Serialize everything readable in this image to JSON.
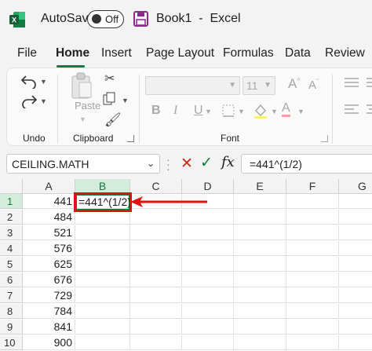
{
  "titlebar": {
    "autosave_label": "AutoSave",
    "toggle_state": "Off",
    "document_title": "Book1  -  Excel",
    "app_icon": "excel-logo",
    "save_icon": "save-icon"
  },
  "menu": {
    "tabs": [
      {
        "label": "File",
        "active": false
      },
      {
        "label": "Home",
        "active": true
      },
      {
        "label": "Insert",
        "active": false
      },
      {
        "label": "Page Layout",
        "active": false
      },
      {
        "label": "Formulas",
        "active": false
      },
      {
        "label": "Data",
        "active": false
      },
      {
        "label": "Review",
        "active": false
      }
    ]
  },
  "ribbon": {
    "groups": [
      {
        "label": "Undo"
      },
      {
        "label": "Clipboard"
      },
      {
        "label": "Font"
      }
    ],
    "paste_label": "Paste",
    "font_size_value": "11",
    "bold_glyph": "B",
    "italic_glyph": "I",
    "underline_glyph": "U"
  },
  "formula_bar": {
    "name_box": "CEILING.MATH",
    "cancel_glyph": "✕",
    "enter_glyph": "✓",
    "fx_label": "fx",
    "formula": "=441^(1/2)"
  },
  "sheet": {
    "columns": [
      "A",
      "B",
      "C",
      "D",
      "E",
      "F",
      "G"
    ],
    "selected_column": "B",
    "rows": [
      {
        "row": "1",
        "a": "441"
      },
      {
        "row": "2",
        "a": "484"
      },
      {
        "row": "3",
        "a": "521"
      },
      {
        "row": "4",
        "a": "576"
      },
      {
        "row": "5",
        "a": "625"
      },
      {
        "row": "6",
        "a": "676"
      },
      {
        "row": "7",
        "a": "729"
      },
      {
        "row": "8",
        "a": "784"
      },
      {
        "row": "9",
        "a": "841"
      },
      {
        "row": "10",
        "a": "900"
      }
    ],
    "editing_cell": "B1",
    "editing_value": "=441^(1/2)"
  },
  "colors": {
    "accent": "#107c41",
    "annotation": "#e01010"
  }
}
